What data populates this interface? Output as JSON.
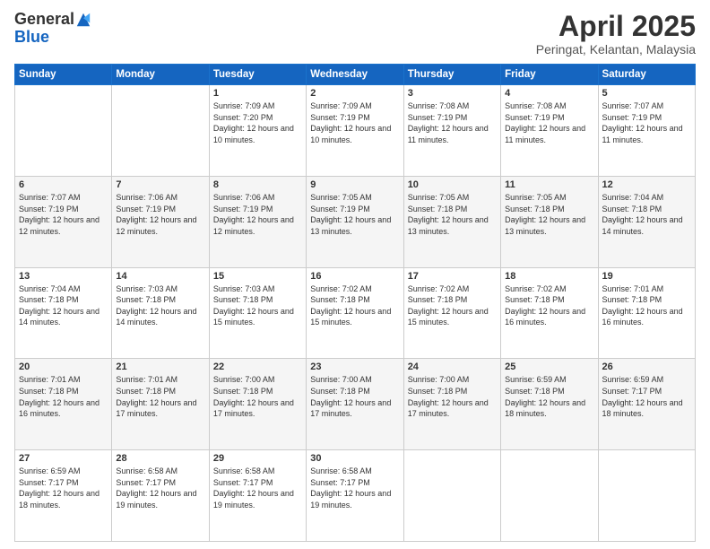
{
  "header": {
    "logo_general": "General",
    "logo_blue": "Blue",
    "month_title": "April 2025",
    "location": "Peringat, Kelantan, Malaysia"
  },
  "weekdays": [
    "Sunday",
    "Monday",
    "Tuesday",
    "Wednesday",
    "Thursday",
    "Friday",
    "Saturday"
  ],
  "weeks": [
    [
      {
        "day": "",
        "sunrise": "",
        "sunset": "",
        "daylight": ""
      },
      {
        "day": "",
        "sunrise": "",
        "sunset": "",
        "daylight": ""
      },
      {
        "day": "1",
        "sunrise": "Sunrise: 7:09 AM",
        "sunset": "Sunset: 7:20 PM",
        "daylight": "Daylight: 12 hours and 10 minutes."
      },
      {
        "day": "2",
        "sunrise": "Sunrise: 7:09 AM",
        "sunset": "Sunset: 7:19 PM",
        "daylight": "Daylight: 12 hours and 10 minutes."
      },
      {
        "day": "3",
        "sunrise": "Sunrise: 7:08 AM",
        "sunset": "Sunset: 7:19 PM",
        "daylight": "Daylight: 12 hours and 11 minutes."
      },
      {
        "day": "4",
        "sunrise": "Sunrise: 7:08 AM",
        "sunset": "Sunset: 7:19 PM",
        "daylight": "Daylight: 12 hours and 11 minutes."
      },
      {
        "day": "5",
        "sunrise": "Sunrise: 7:07 AM",
        "sunset": "Sunset: 7:19 PM",
        "daylight": "Daylight: 12 hours and 11 minutes."
      }
    ],
    [
      {
        "day": "6",
        "sunrise": "Sunrise: 7:07 AM",
        "sunset": "Sunset: 7:19 PM",
        "daylight": "Daylight: 12 hours and 12 minutes."
      },
      {
        "day": "7",
        "sunrise": "Sunrise: 7:06 AM",
        "sunset": "Sunset: 7:19 PM",
        "daylight": "Daylight: 12 hours and 12 minutes."
      },
      {
        "day": "8",
        "sunrise": "Sunrise: 7:06 AM",
        "sunset": "Sunset: 7:19 PM",
        "daylight": "Daylight: 12 hours and 12 minutes."
      },
      {
        "day": "9",
        "sunrise": "Sunrise: 7:05 AM",
        "sunset": "Sunset: 7:19 PM",
        "daylight": "Daylight: 12 hours and 13 minutes."
      },
      {
        "day": "10",
        "sunrise": "Sunrise: 7:05 AM",
        "sunset": "Sunset: 7:18 PM",
        "daylight": "Daylight: 12 hours and 13 minutes."
      },
      {
        "day": "11",
        "sunrise": "Sunrise: 7:05 AM",
        "sunset": "Sunset: 7:18 PM",
        "daylight": "Daylight: 12 hours and 13 minutes."
      },
      {
        "day": "12",
        "sunrise": "Sunrise: 7:04 AM",
        "sunset": "Sunset: 7:18 PM",
        "daylight": "Daylight: 12 hours and 14 minutes."
      }
    ],
    [
      {
        "day": "13",
        "sunrise": "Sunrise: 7:04 AM",
        "sunset": "Sunset: 7:18 PM",
        "daylight": "Daylight: 12 hours and 14 minutes."
      },
      {
        "day": "14",
        "sunrise": "Sunrise: 7:03 AM",
        "sunset": "Sunset: 7:18 PM",
        "daylight": "Daylight: 12 hours and 14 minutes."
      },
      {
        "day": "15",
        "sunrise": "Sunrise: 7:03 AM",
        "sunset": "Sunset: 7:18 PM",
        "daylight": "Daylight: 12 hours and 15 minutes."
      },
      {
        "day": "16",
        "sunrise": "Sunrise: 7:02 AM",
        "sunset": "Sunset: 7:18 PM",
        "daylight": "Daylight: 12 hours and 15 minutes."
      },
      {
        "day": "17",
        "sunrise": "Sunrise: 7:02 AM",
        "sunset": "Sunset: 7:18 PM",
        "daylight": "Daylight: 12 hours and 15 minutes."
      },
      {
        "day": "18",
        "sunrise": "Sunrise: 7:02 AM",
        "sunset": "Sunset: 7:18 PM",
        "daylight": "Daylight: 12 hours and 16 minutes."
      },
      {
        "day": "19",
        "sunrise": "Sunrise: 7:01 AM",
        "sunset": "Sunset: 7:18 PM",
        "daylight": "Daylight: 12 hours and 16 minutes."
      }
    ],
    [
      {
        "day": "20",
        "sunrise": "Sunrise: 7:01 AM",
        "sunset": "Sunset: 7:18 PM",
        "daylight": "Daylight: 12 hours and 16 minutes."
      },
      {
        "day": "21",
        "sunrise": "Sunrise: 7:01 AM",
        "sunset": "Sunset: 7:18 PM",
        "daylight": "Daylight: 12 hours and 17 minutes."
      },
      {
        "day": "22",
        "sunrise": "Sunrise: 7:00 AM",
        "sunset": "Sunset: 7:18 PM",
        "daylight": "Daylight: 12 hours and 17 minutes."
      },
      {
        "day": "23",
        "sunrise": "Sunrise: 7:00 AM",
        "sunset": "Sunset: 7:18 PM",
        "daylight": "Daylight: 12 hours and 17 minutes."
      },
      {
        "day": "24",
        "sunrise": "Sunrise: 7:00 AM",
        "sunset": "Sunset: 7:18 PM",
        "daylight": "Daylight: 12 hours and 17 minutes."
      },
      {
        "day": "25",
        "sunrise": "Sunrise: 6:59 AM",
        "sunset": "Sunset: 7:18 PM",
        "daylight": "Daylight: 12 hours and 18 minutes."
      },
      {
        "day": "26",
        "sunrise": "Sunrise: 6:59 AM",
        "sunset": "Sunset: 7:17 PM",
        "daylight": "Daylight: 12 hours and 18 minutes."
      }
    ],
    [
      {
        "day": "27",
        "sunrise": "Sunrise: 6:59 AM",
        "sunset": "Sunset: 7:17 PM",
        "daylight": "Daylight: 12 hours and 18 minutes."
      },
      {
        "day": "28",
        "sunrise": "Sunrise: 6:58 AM",
        "sunset": "Sunset: 7:17 PM",
        "daylight": "Daylight: 12 hours and 19 minutes."
      },
      {
        "day": "29",
        "sunrise": "Sunrise: 6:58 AM",
        "sunset": "Sunset: 7:17 PM",
        "daylight": "Daylight: 12 hours and 19 minutes."
      },
      {
        "day": "30",
        "sunrise": "Sunrise: 6:58 AM",
        "sunset": "Sunset: 7:17 PM",
        "daylight": "Daylight: 12 hours and 19 minutes."
      },
      {
        "day": "",
        "sunrise": "",
        "sunset": "",
        "daylight": ""
      },
      {
        "day": "",
        "sunrise": "",
        "sunset": "",
        "daylight": ""
      },
      {
        "day": "",
        "sunrise": "",
        "sunset": "",
        "daylight": ""
      }
    ]
  ]
}
